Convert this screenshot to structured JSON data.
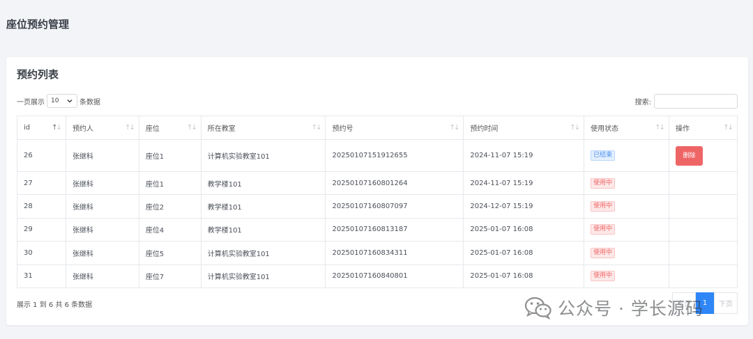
{
  "page": {
    "title": "座位预约管理"
  },
  "card": {
    "title": "预约列表"
  },
  "length": {
    "prefix": "一页展示",
    "value": "10",
    "suffix": "条数据"
  },
  "search": {
    "label": "搜索:",
    "value": ""
  },
  "table": {
    "columns": [
      "id",
      "预约人",
      "座位",
      "所在教室",
      "预约号",
      "预约时间",
      "使用状态",
      "操作"
    ],
    "rows": [
      {
        "id": "26",
        "person": "张继科",
        "seat": "座位1",
        "room": "计算机实验教室101",
        "code": "20250107151912655",
        "time": "2024-11-07 15:19",
        "status": "已结束",
        "status_type": "ended",
        "action": "删除"
      },
      {
        "id": "27",
        "person": "张继科",
        "seat": "座位1",
        "room": "教学楼101",
        "code": "20250107160801264",
        "time": "2024-11-07 15:19",
        "status": "使用中",
        "status_type": "using",
        "action": ""
      },
      {
        "id": "28",
        "person": "张继科",
        "seat": "座位2",
        "room": "教学楼101",
        "code": "20250107160807097",
        "time": "2024-12-07 15:19",
        "status": "使用中",
        "status_type": "using",
        "action": ""
      },
      {
        "id": "29",
        "person": "张继科",
        "seat": "座位4",
        "room": "教学楼101",
        "code": "20250107160813187",
        "time": "2025-01-07 16:08",
        "status": "使用中",
        "status_type": "using",
        "action": ""
      },
      {
        "id": "30",
        "person": "张继科",
        "seat": "座位5",
        "room": "计算机实验教室101",
        "code": "20250107160834311",
        "time": "2025-01-07 16:08",
        "status": "使用中",
        "status_type": "using",
        "action": ""
      },
      {
        "id": "31",
        "person": "张继科",
        "seat": "座位7",
        "room": "计算机实验教室101",
        "code": "20250107160840801",
        "time": "2025-01-07 16:08",
        "status": "使用中",
        "status_type": "using",
        "action": ""
      }
    ]
  },
  "info": {
    "text": "展示 1 到 6 共 6 条数据"
  },
  "pager": {
    "prev": "上页",
    "current": "1",
    "next": "下页"
  },
  "watermark": {
    "text": "公众号 · 学长源码"
  },
  "colors": {
    "accent": "#2f86f6",
    "danger": "#ee6566",
    "ended_badge": "#4b8ff2",
    "using_badge": "#f06565"
  },
  "icons": {
    "select_arrow": "chevron-down-icon",
    "sort": "sort-arrows-icon",
    "watermark": "wechat-icon"
  }
}
